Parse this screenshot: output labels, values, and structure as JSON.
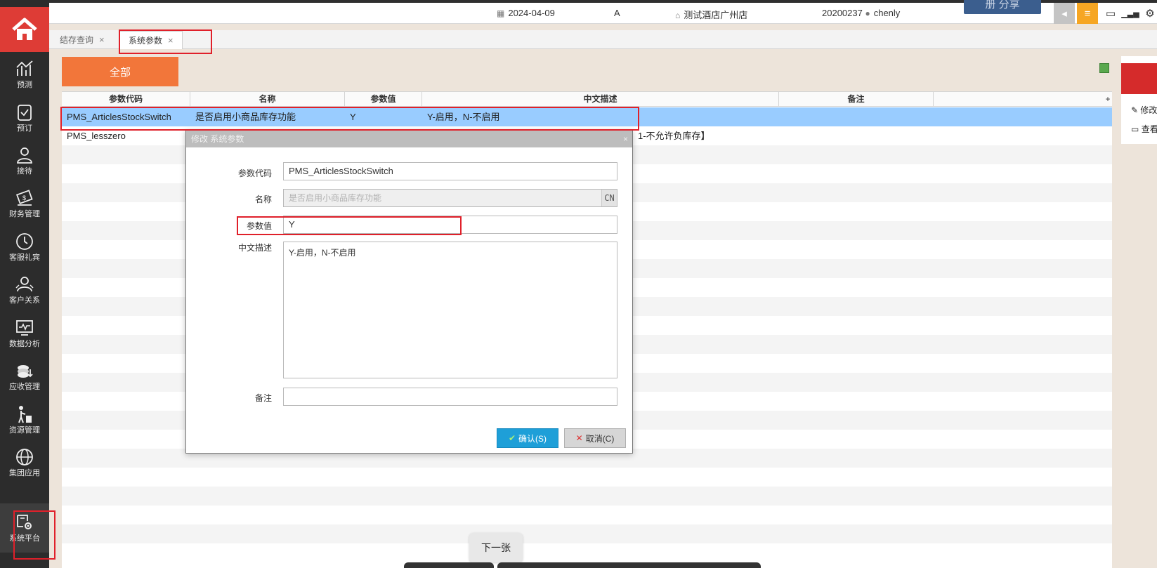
{
  "topbar": {
    "date": "2024-04-09",
    "shift": "A",
    "hotel": "测试酒店广州店",
    "user_id": "20200237",
    "user_name": "chenly",
    "share_label": "册 分享"
  },
  "sidebar": {
    "items": [
      {
        "label": "预测",
        "icon": "chart-icon"
      },
      {
        "label": "预订",
        "icon": "clipboard-icon"
      },
      {
        "label": "接待",
        "icon": "person-icon"
      },
      {
        "label": "财务管理",
        "icon": "money-icon"
      },
      {
        "label": "客服礼宾",
        "icon": "clock-icon"
      },
      {
        "label": "客户关系",
        "icon": "users-icon"
      },
      {
        "label": "数据分析",
        "icon": "monitor-chart-icon"
      },
      {
        "label": "应收管理",
        "icon": "coins-icon"
      },
      {
        "label": "资源管理",
        "icon": "cleaner-icon"
      },
      {
        "label": "集团应用",
        "icon": "globe-icon"
      },
      {
        "label": "系统平台",
        "icon": "system-gear-icon"
      }
    ]
  },
  "tabs": [
    {
      "label": "结存查询",
      "close": "×"
    },
    {
      "label": "系统参数",
      "close": "×"
    }
  ],
  "toolbar": {
    "all_label": "全部"
  },
  "grid": {
    "columns": [
      "参数代码",
      "名称",
      "参数值",
      "中文描述",
      "备注"
    ],
    "rows": [
      {
        "code": "PMS_ArticlesStockSwitch",
        "name": "是否启用小商品库存功能",
        "value": "Y",
        "desc": "Y-启用，N-不启用",
        "remark": ""
      },
      {
        "code": "PMS_lesszero",
        "name": "",
        "value": "",
        "desc": "1-不允许负库存】",
        "remark": ""
      }
    ],
    "header_extra": "+"
  },
  "right_panel": {
    "edit_label": "修改",
    "view_label": "查看"
  },
  "dialog": {
    "title": "修改 系统参数",
    "close": "×",
    "fields": {
      "code_label": "参数代码",
      "code_value": "PMS_ArticlesStockSwitch",
      "name_label": "名称",
      "name_value": "是否启用小商品库存功能",
      "name_lang": "CN",
      "value_label": "参数值",
      "value_value": "Y",
      "desc_label": "中文描述",
      "desc_value": "Y-启用，N-不启用",
      "remark_label": "备注",
      "remark_value": ""
    },
    "ok_label": "确认(S)",
    "cancel_label": "取消(C)"
  },
  "next_tip": "下一张",
  "colors": {
    "accent_red": "#de3c36",
    "orange": "#f2763a",
    "selected_row": "#99ccff",
    "ok_blue": "#1e9fd8"
  }
}
